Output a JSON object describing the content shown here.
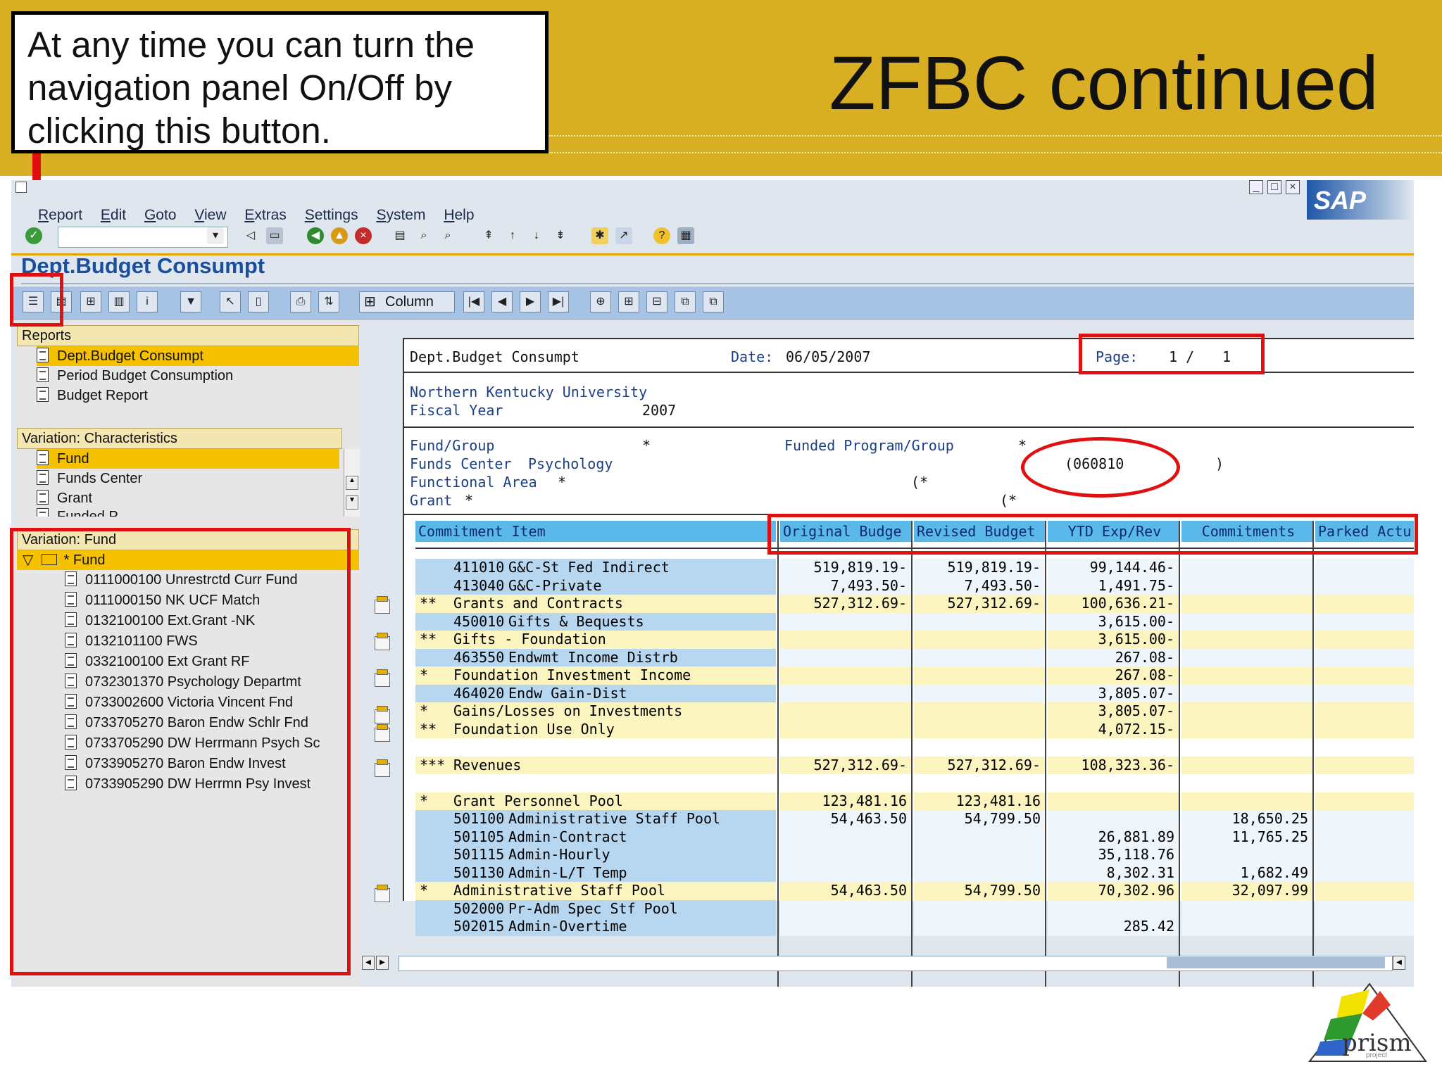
{
  "slide": {
    "title": "ZFBC continued",
    "callout_text": "At any time you can turn the navigation panel On/Off by clicking this button.",
    "logo_text": "prism",
    "logo_subtext": "project"
  },
  "sap": {
    "menu": [
      "Report",
      "Edit",
      "Goto",
      "View",
      "Extras",
      "Settings",
      "System",
      "Help"
    ],
    "logo": "SAP",
    "command_field": "",
    "app_title": "Dept.Budget Consumpt",
    "column_button": "Column",
    "colors": {
      "tableheader": "#5bb8ea",
      "highlight_row": "#f6c200",
      "annotation_red": "#e01010",
      "banner": "#d8ae22"
    }
  },
  "nav": {
    "reports_header": "Reports",
    "reports": [
      "Dept.Budget Consumpt",
      "Period Budget Consumption",
      "Budget Report"
    ],
    "char_header": "Variation: Characteristics",
    "characteristics": [
      "Fund",
      "Funds Center",
      "Grant",
      "Funded P..."
    ],
    "fund_header": "Variation: Fund",
    "fund_root": "* Fund",
    "funds": [
      "0111000100 Unrestrctd Curr Fund",
      "0111000150 NK UCF Match",
      "0132100100 Ext.Grant -NK",
      "0132101100 FWS",
      "0332100100 Ext Grant RF",
      "0732301370 Psychology Departmt",
      "0733002600 Victoria Vincent Fnd",
      "0733705270 Baron Endw Schlr Fnd",
      "0733705290 DW Herrmann Psych Sc",
      "0733905270 Baron Endw Invest",
      "0733905290 DW Herrmn Psy Invest"
    ]
  },
  "report": {
    "name": "Dept.Budget Consumpt",
    "date_label": "Date:",
    "date": "06/05/2007",
    "page_label": "Page:",
    "page": "1 /",
    "page_total": "1",
    "org": "Northern Kentucky University",
    "fiscal_year_label": "Fiscal Year",
    "fiscal_year": "2007",
    "fund_group_label": "Fund/Group",
    "fund_group_value": "*",
    "funds_center_label": "Funds Center",
    "funds_center_value": "Psychology",
    "functional_area_label": "Functional Area",
    "functional_area_value": "*",
    "grant_label": "Grant",
    "grant_value": "*",
    "funded_program_label": "Funded Program/Group",
    "funded_program_value": "*",
    "funded_program_code": "(060810",
    "funded_program_close": ")",
    "functional_area_paren": "(*",
    "grant_paren": "(*",
    "columns": [
      "Commitment Item",
      "Original Budge",
      "Revised Budget",
      "YTD Exp/Rev",
      "Commitments",
      "Parked Actu"
    ],
    "rows": [
      {
        "lvl": "",
        "code": "411010",
        "desc": "G&C-St Fed Indirect",
        "orig": "519,819.19-",
        "rev": "519,819.19-",
        "ytd": "99,144.46-",
        "com": "",
        "park": "",
        "style": "blue"
      },
      {
        "lvl": "",
        "code": "413040",
        "desc": "G&C-Private",
        "orig": "7,493.50-",
        "rev": "7,493.50-",
        "ytd": "1,491.75-",
        "com": "",
        "park": "",
        "style": "blue"
      },
      {
        "lvl": "**",
        "code": "",
        "desc": "Grants and Contracts",
        "orig": "527,312.69-",
        "rev": "527,312.69-",
        "ytd": "100,636.21-",
        "com": "",
        "park": "",
        "style": "yellow"
      },
      {
        "lvl": "",
        "code": "450010",
        "desc": "Gifts & Bequests",
        "orig": "",
        "rev": "",
        "ytd": "3,615.00-",
        "com": "",
        "park": "",
        "style": "blue"
      },
      {
        "lvl": "**",
        "code": "",
        "desc": "Gifts - Foundation",
        "orig": "",
        "rev": "",
        "ytd": "3,615.00-",
        "com": "",
        "park": "",
        "style": "yellow"
      },
      {
        "lvl": "",
        "code": "463550",
        "desc": "Endwmt Income Distrb",
        "orig": "",
        "rev": "",
        "ytd": "267.08-",
        "com": "",
        "park": "",
        "style": "blue"
      },
      {
        "lvl": "*",
        "code": "",
        "desc": "Foundation Investment Income",
        "orig": "",
        "rev": "",
        "ytd": "267.08-",
        "com": "",
        "park": "",
        "style": "yellow"
      },
      {
        "lvl": "",
        "code": "464020",
        "desc": "Endw Gain-Dist",
        "orig": "",
        "rev": "",
        "ytd": "3,805.07-",
        "com": "",
        "park": "",
        "style": "blue"
      },
      {
        "lvl": "*",
        "code": "",
        "desc": "Gains/Losses on Investments",
        "orig": "",
        "rev": "",
        "ytd": "3,805.07-",
        "com": "",
        "park": "",
        "style": "yellow"
      },
      {
        "lvl": "**",
        "code": "",
        "desc": "Foundation Use Only",
        "orig": "",
        "rev": "",
        "ytd": "4,072.15-",
        "com": "",
        "park": "",
        "style": "yellow"
      },
      {
        "lvl": "",
        "code": "",
        "desc": "",
        "orig": "",
        "rev": "",
        "ytd": "",
        "com": "",
        "park": "",
        "style": "blank"
      },
      {
        "lvl": "***",
        "code": "",
        "desc": "Revenues",
        "orig": "527,312.69-",
        "rev": "527,312.69-",
        "ytd": "108,323.36-",
        "com": "",
        "park": "",
        "style": "yellow"
      },
      {
        "lvl": "",
        "code": "",
        "desc": "",
        "orig": "",
        "rev": "",
        "ytd": "",
        "com": "",
        "park": "",
        "style": "blank"
      },
      {
        "lvl": "*",
        "code": "",
        "desc": "Grant Personnel Pool",
        "orig": "123,481.16",
        "rev": "123,481.16",
        "ytd": "",
        "com": "",
        "park": "",
        "style": "yellow"
      },
      {
        "lvl": "",
        "code": "501100",
        "desc": "Administrative Staff Pool",
        "orig": "54,463.50",
        "rev": "54,799.50",
        "ytd": "",
        "com": "18,650.25",
        "park": "",
        "style": "blue"
      },
      {
        "lvl": "",
        "code": "501105",
        "desc": "Admin-Contract",
        "orig": "",
        "rev": "",
        "ytd": "26,881.89",
        "com": "11,765.25",
        "park": "",
        "style": "blue"
      },
      {
        "lvl": "",
        "code": "501115",
        "desc": "Admin-Hourly",
        "orig": "",
        "rev": "",
        "ytd": "35,118.76",
        "com": "",
        "park": "",
        "style": "blue"
      },
      {
        "lvl": "",
        "code": "501130",
        "desc": "Admin-L/T Temp",
        "orig": "",
        "rev": "",
        "ytd": "8,302.31",
        "com": "1,682.49",
        "park": "",
        "style": "blue"
      },
      {
        "lvl": "*",
        "code": "",
        "desc": "Administrative Staff Pool",
        "orig": "54,463.50",
        "rev": "54,799.50",
        "ytd": "70,302.96",
        "com": "32,097.99",
        "park": "",
        "style": "yellow"
      },
      {
        "lvl": "",
        "code": "502000",
        "desc": "Pr-Adm Spec Stf Pool",
        "orig": "",
        "rev": "",
        "ytd": "",
        "com": "",
        "park": "",
        "style": "blue"
      },
      {
        "lvl": "",
        "code": "502015",
        "desc": "Admin-Overtime",
        "orig": "",
        "rev": "",
        "ytd": "285.42",
        "com": "",
        "park": "",
        "style": "blue"
      }
    ]
  }
}
